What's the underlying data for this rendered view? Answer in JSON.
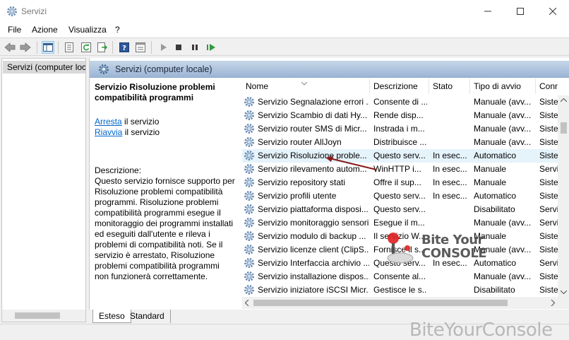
{
  "window": {
    "title": "Servizi"
  },
  "menu": [
    "File",
    "Azione",
    "Visualizza",
    "?"
  ],
  "tree": {
    "root": "Servizi (computer locale)"
  },
  "banner": {
    "title": "Servizi (computer locale)"
  },
  "details": {
    "service_title": "Servizio Risoluzione problemi compatibilità programmi",
    "stop_link": "Arresta",
    "stop_suffix": " il servizio",
    "restart_link": "Riavvia",
    "restart_suffix": " il servizio",
    "description_label": "Descrizione:",
    "description": "Questo servizio fornisce supporto per Risoluzione problemi compatibilità programmi. Risoluzione problemi compatibilità programmi esegue il monitoraggio dei programmi installati ed eseguiti dall'utente e rileva i problemi di compatibilità noti. Se il servizio è arrestato, Risoluzione problemi compatibilità programmi non funzionerà correttamente."
  },
  "columns": [
    "Nome",
    "Descrizione",
    "Stato",
    "Tipo di avvio",
    "Conn"
  ],
  "rows": [
    {
      "name": "Servizio Segnalazione errori ...",
      "desc": "Consente di ...",
      "state": "",
      "startup": "Manuale (avv...",
      "conn": "Siste"
    },
    {
      "name": "Servizio Scambio di dati Hy...",
      "desc": "Rende disp...",
      "state": "",
      "startup": "Manuale (avv...",
      "conn": "Siste"
    },
    {
      "name": "Servizio router SMS di Micr...",
      "desc": "Instrada i m...",
      "state": "",
      "startup": "Manuale (avv...",
      "conn": "Siste"
    },
    {
      "name": "Servizio router AllJoyn",
      "desc": "Distribuisce ...",
      "state": "",
      "startup": "Manuale (avv...",
      "conn": "Siste"
    },
    {
      "name": "Servizio Risoluzione proble...",
      "desc": "Questo serv...",
      "state": "In esec...",
      "startup": "Automatico",
      "conn": "Siste",
      "highlight": true
    },
    {
      "name": "Servizio rilevamento autom...",
      "desc": "WinHTTP i...",
      "state": "In esec...",
      "startup": "Manuale",
      "conn": "Servi"
    },
    {
      "name": "Servizio repository stati",
      "desc": "Offre il sup...",
      "state": "In esec...",
      "startup": "Manuale",
      "conn": "Siste"
    },
    {
      "name": "Servizio profili utente",
      "desc": "Questo serv...",
      "state": "In esec...",
      "startup": "Automatico",
      "conn": "Siste"
    },
    {
      "name": "Servizio piattaforma disposi...",
      "desc": "Questo serv...",
      "state": "",
      "startup": "Disabilitato",
      "conn": "Servi"
    },
    {
      "name": "Servizio monitoraggio sensori",
      "desc": "Esegue il m...",
      "state": "",
      "startup": "Manuale (avv...",
      "conn": "Servi"
    },
    {
      "name": "Servizio modulo di backup ...",
      "desc": "Il servizio W...",
      "state": "",
      "startup": "Manuale",
      "conn": "Siste"
    },
    {
      "name": "Servizio licenze client (ClipS...",
      "desc": "Fornisce il s...",
      "state": "",
      "startup": "Manuale (avv...",
      "conn": "Siste"
    },
    {
      "name": "Servizio Interfaccia archivio ...",
      "desc": "Questo serv...",
      "state": "In esec...",
      "startup": "Automatico",
      "conn": "Servi"
    },
    {
      "name": "Servizio installazione dispos...",
      "desc": "Consente al...",
      "state": "",
      "startup": "Manuale (avv...",
      "conn": "Siste"
    },
    {
      "name": "Servizio iniziatore iSCSI Micr...",
      "desc": "Gestisce le s...",
      "state": "",
      "startup": "Disabilitato",
      "conn": "Siste"
    }
  ],
  "tabs": [
    "Esteso",
    "Standard"
  ],
  "watermark": {
    "small_line1": "Bite Your",
    "small_line2": "CONSOLE",
    "big": "BiteYourConsole"
  },
  "colors": {
    "highlight_row": "#e5f3fb",
    "arrow": "#8b1a1a",
    "link": "#0066cc"
  }
}
